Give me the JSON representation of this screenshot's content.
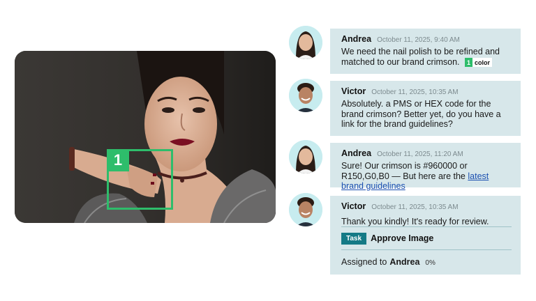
{
  "marker": {
    "number": "1"
  },
  "messages": [
    {
      "author": "Andrea",
      "time": "October 11, 2025, 9:40 AM",
      "text": "We need the nail polish to be refined and matched to our brand crimson.",
      "tag_number": "1",
      "tag_label": "color"
    },
    {
      "author": "Victor",
      "time": "October 11, 2025, 10:35 AM",
      "text": "Absolutely.   a PMS or HEX code for the brand crimson? Better yet, do you have a link for the brand guidelines?"
    },
    {
      "author": "Andrea",
      "time": "October 11, 2025, 11:20 AM",
      "text": "Sure! Our crimson is #960000 or R150,G0,B0 — But here are the",
      "link": "latest brand guidelines"
    },
    {
      "author": "Victor",
      "time": "October 11, 2025, 10:35 AM",
      "text": "Thank you kindly! It's ready for review.",
      "task_badge": "Task",
      "task_title": "Approve Image",
      "assigned_prefix": "Assigned to",
      "assignee": "Andrea",
      "progress": "0%"
    }
  ],
  "colors": {
    "bubble": "#d7e7ea",
    "marker": "#2ebd6b",
    "task_badge": "#147a86",
    "link": "#1a4fb0"
  }
}
